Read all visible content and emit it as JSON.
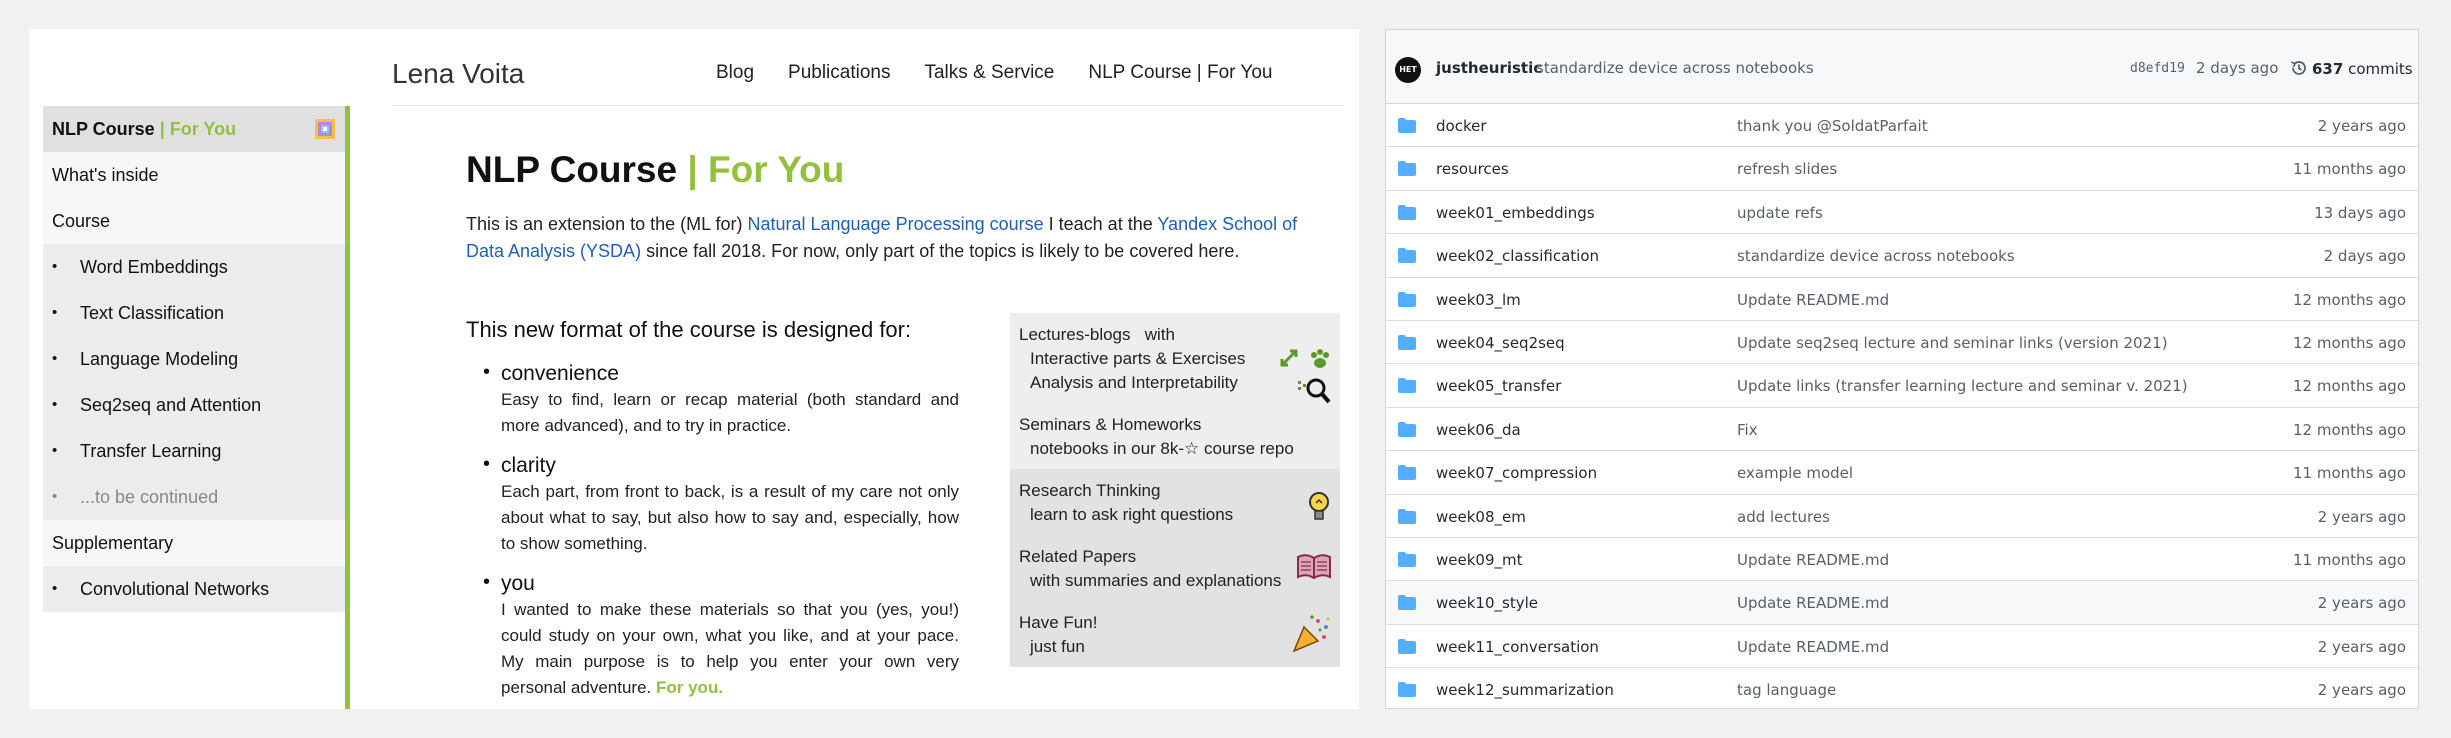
{
  "site": {
    "title": "Lena Voita",
    "nav": [
      "Blog",
      "Publications",
      "Talks & Service",
      "NLP Course | For You"
    ]
  },
  "sidebar": {
    "header": {
      "main": "NLP Course",
      "accent": " | For You"
    },
    "items": [
      {
        "label": "What's inside",
        "kind": "plain"
      },
      {
        "label": "Course",
        "kind": "plain"
      },
      {
        "label": "Word Embeddings",
        "kind": "sub"
      },
      {
        "label": "Text Classification",
        "kind": "sub"
      },
      {
        "label": "Language Modeling",
        "kind": "sub"
      },
      {
        "label": "Seq2seq and Attention",
        "kind": "sub"
      },
      {
        "label": "Transfer Learning",
        "kind": "sub"
      },
      {
        "label": "...to be continued",
        "kind": "sub-muted"
      },
      {
        "label": "Supplementary",
        "kind": "plain"
      },
      {
        "label": "Convolutional Networks",
        "kind": "sub"
      }
    ]
  },
  "main": {
    "title_main": "NLP Course",
    "title_accent": " | For You",
    "intro": {
      "t1": "This is an extension to the (ML for) ",
      "link1": "Natural Language Processing course",
      "t2": " I teach at the ",
      "link2": "Yandex School of Data Analysis (YSDA)",
      "t3": " since fall 2018. For now, only part of the topics is likely to be covered here."
    },
    "designed_for": "This new format of the course is designed for:",
    "features": [
      {
        "title": "convenience",
        "desc": "Easy to find, learn or recap material (both standard and more advanced), and to try in practice."
      },
      {
        "title": "clarity",
        "desc": "Each part, from front to back, is a result of my care not only about what to say, but also how to say and, especially, how to show something."
      },
      {
        "title": "you",
        "desc": "I wanted to make these materials so that you (yes, you!) could study on your own, what you like, and at your pace. My main purpose is to help you enter your own very personal adventure. ",
        "accent": "For you."
      }
    ],
    "panel": {
      "lectures": {
        "title": "Lectures-blogs",
        "with": "with",
        "lines": [
          "Interactive parts & Exercises",
          "Analysis and Interpretability"
        ]
      },
      "seminars": {
        "title": "Seminars & Homeworks",
        "line": "notebooks in our 8k-☆ course repo"
      },
      "research": {
        "title": "Research Thinking",
        "line": "learn to ask right questions"
      },
      "papers": {
        "title": "Related Papers",
        "line": "with summaries and explanations"
      },
      "fun": {
        "title": "Have Fun!",
        "line": "just fun"
      }
    }
  },
  "github": {
    "avatar_text": "НЕТ",
    "author": "justheuristic",
    "message": "standardize device across notebooks",
    "sha": "d8efd19",
    "age": "2 days ago",
    "commit_count": "637",
    "commits_label": "commits",
    "files": [
      {
        "name": "docker",
        "message": "thank you @SoldatParfait",
        "age": "2 years ago"
      },
      {
        "name": "resources",
        "message": "refresh slides",
        "age": "11 months ago"
      },
      {
        "name": "week01_embeddings",
        "message": "update refs",
        "age": "13 days ago"
      },
      {
        "name": "week02_classification",
        "message": "standardize device across notebooks",
        "age": "2 days ago"
      },
      {
        "name": "week03_lm",
        "message": "Update README.md",
        "age": "12 months ago"
      },
      {
        "name": "week04_seq2seq",
        "message": "Update seq2seq lecture and seminar links (version 2021)",
        "age": "12 months ago"
      },
      {
        "name": "week05_transfer",
        "message": "Update links (transfer learning lecture and seminar v. 2021)",
        "age": "12 months ago"
      },
      {
        "name": "week06_da",
        "message": "Fix",
        "age": "12 months ago"
      },
      {
        "name": "week07_compression",
        "message": "example model",
        "age": "11 months ago"
      },
      {
        "name": "week08_em",
        "message": "add lectures",
        "age": "2 years ago"
      },
      {
        "name": "week09_mt",
        "message": "Update README.md",
        "age": "11 months ago"
      },
      {
        "name": "week10_style",
        "message": "Update README.md",
        "age": "2 years ago"
      },
      {
        "name": "week11_conversation",
        "message": "Update README.md",
        "age": "2 years ago"
      },
      {
        "name": "week12_summarization",
        "message": "tag language",
        "age": "2 years ago"
      }
    ],
    "hover_row_index": 11,
    "colors": {
      "folder": "#54aeff",
      "accent_green": "#92c13f",
      "link_blue": "#1f5fb5"
    }
  }
}
